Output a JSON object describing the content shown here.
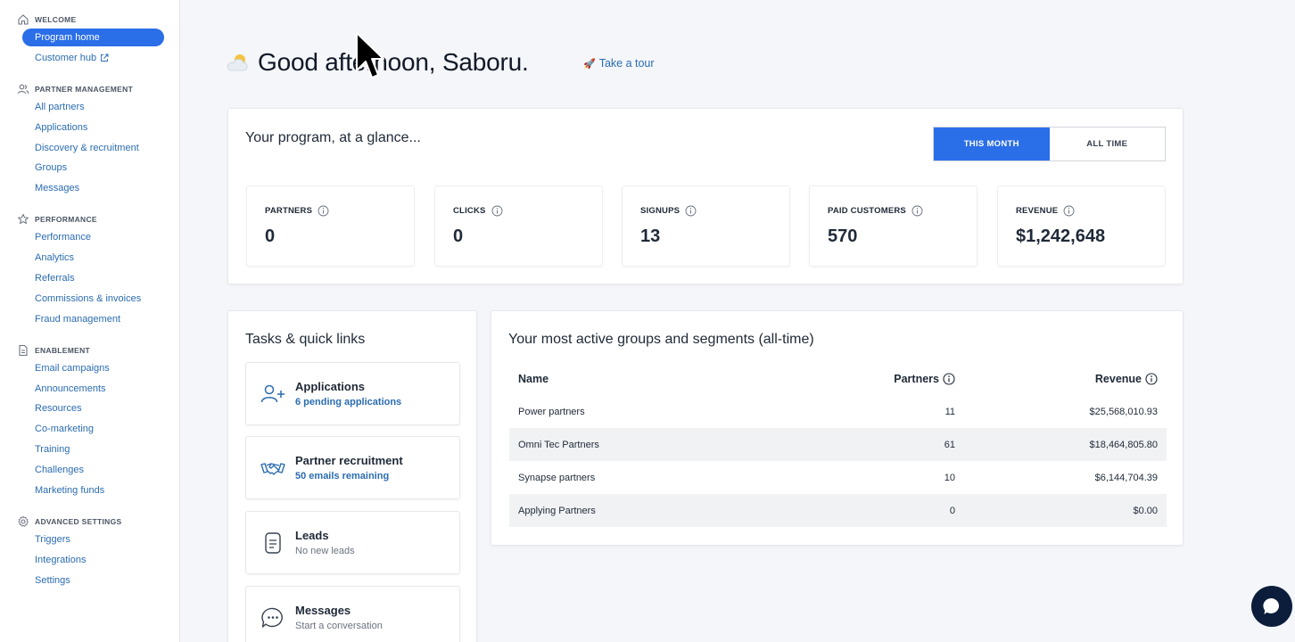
{
  "sidebar": {
    "sections": [
      {
        "title": "WELCOME",
        "icon": "home-icon",
        "items": [
          {
            "label": "Program home",
            "active": true
          },
          {
            "label": "Customer hub",
            "external": true
          }
        ]
      },
      {
        "title": "PARTNER MANAGEMENT",
        "icon": "users-icon",
        "items": [
          {
            "label": "All partners"
          },
          {
            "label": "Applications"
          },
          {
            "label": "Discovery & recruitment"
          },
          {
            "label": "Groups"
          },
          {
            "label": "Messages"
          }
        ]
      },
      {
        "title": "PERFORMANCE",
        "icon": "star-icon",
        "items": [
          {
            "label": "Performance"
          },
          {
            "label": "Analytics"
          },
          {
            "label": "Referrals"
          },
          {
            "label": "Commissions & invoices"
          },
          {
            "label": "Fraud management"
          }
        ]
      },
      {
        "title": "ENABLEMENT",
        "icon": "document-icon",
        "items": [
          {
            "label": "Email campaigns"
          },
          {
            "label": "Announcements"
          },
          {
            "label": "Resources"
          },
          {
            "label": "Co-marketing"
          },
          {
            "label": "Training"
          },
          {
            "label": "Challenges"
          },
          {
            "label": "Marketing funds"
          }
        ]
      },
      {
        "title": "ADVANCED SETTINGS",
        "icon": "gear-icon",
        "items": [
          {
            "label": "Triggers"
          },
          {
            "label": "Integrations"
          },
          {
            "label": "Settings"
          }
        ]
      }
    ]
  },
  "header": {
    "greeting": "Good afternoon, Saboru.",
    "tour_label": "Take a tour",
    "tour_icon": "🚀"
  },
  "glance": {
    "title": "Your program, at a glance...",
    "toggle": {
      "this_month": "THIS MONTH",
      "all_time": "ALL TIME"
    },
    "stats": [
      {
        "label": "PARTNERS",
        "value": "0"
      },
      {
        "label": "CLICKS",
        "value": "0"
      },
      {
        "label": "SIGNUPS",
        "value": "13"
      },
      {
        "label": "PAID CUSTOMERS",
        "value": "570"
      },
      {
        "label": "REVENUE",
        "value": "$1,242,648"
      }
    ]
  },
  "tasks": {
    "title": "Tasks & quick links",
    "items": [
      {
        "title": "Applications",
        "subtitle": "6 pending applications",
        "link": true,
        "icon": "add-user-icon"
      },
      {
        "title": "Partner recruitment",
        "subtitle": "50 emails remaining",
        "link": true,
        "icon": "handshake-icon"
      },
      {
        "title": "Leads",
        "subtitle": "No new leads",
        "link": false,
        "icon": "list-document-icon"
      },
      {
        "title": "Messages",
        "subtitle": "Start a conversation",
        "link": false,
        "icon": "chat-bubble-icon"
      }
    ]
  },
  "groups": {
    "title": "Your most active groups and segments (all-time)",
    "columns": {
      "name": "Name",
      "partners": "Partners",
      "revenue": "Revenue"
    },
    "rows": [
      {
        "name": "Power partners",
        "partners": "11",
        "revenue": "$25,568,010.93"
      },
      {
        "name": "Omni Tec Partners",
        "partners": "61",
        "revenue": "$18,464,805.80"
      },
      {
        "name": "Synapse partners",
        "partners": "10",
        "revenue": "$6,144,704.39"
      },
      {
        "name": "Applying Partners",
        "partners": "0",
        "revenue": "$0.00"
      }
    ]
  },
  "colors": {
    "accent": "#2a6ee8",
    "link": "#2b6cb0",
    "chat": "#0b1d3a"
  }
}
